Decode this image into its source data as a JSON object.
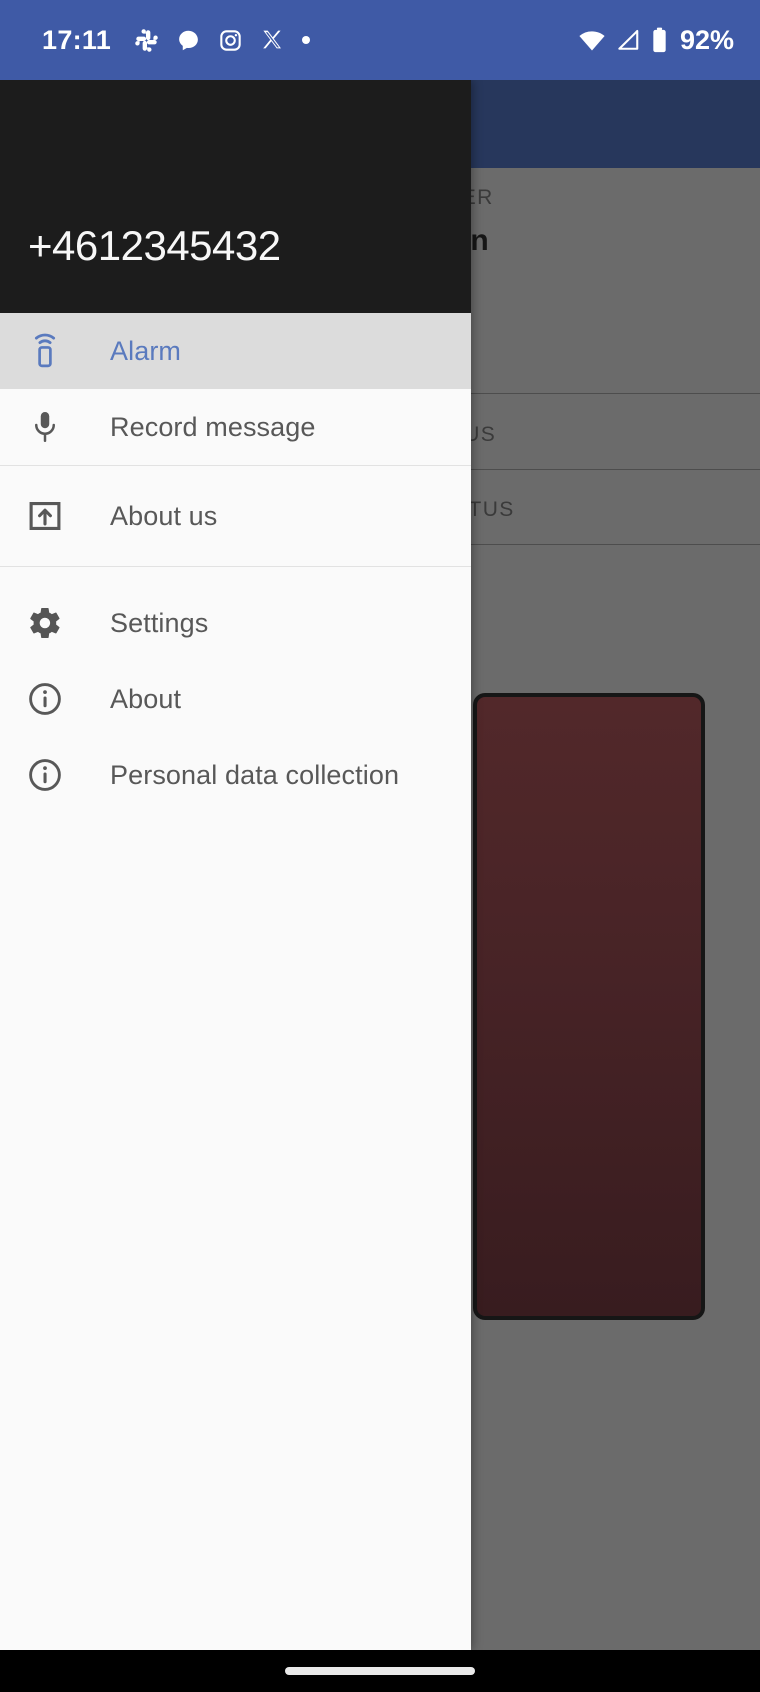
{
  "status_bar": {
    "time": "17:11",
    "battery_percent": "92%",
    "left_icons": [
      "slack-icon",
      "message-icon",
      "instagram-icon",
      "x-icon",
      "dot-icon"
    ],
    "right_icons": [
      "wifi-icon",
      "cellular-signal-icon",
      "battery-icon"
    ],
    "background_color": "#3f5aa6"
  },
  "drawer": {
    "header": {
      "phone_number": "+4612345432",
      "background_color": "#1c1c1c"
    },
    "selected_color": "#5a7abe",
    "selected_row_background": "#dcdcdc",
    "groups": [
      {
        "items": [
          {
            "label": "Alarm",
            "icon": "remote-signal-icon",
            "selected": true
          },
          {
            "label": "Record message",
            "icon": "microphone-icon",
            "selected": false
          }
        ]
      },
      {
        "items": [
          {
            "label": "About us",
            "icon": "open-in-new-icon",
            "selected": false
          }
        ]
      },
      {
        "items": [
          {
            "label": "Settings",
            "icon": "gear-icon",
            "selected": false
          },
          {
            "label": "About",
            "icon": "info-circle-icon",
            "selected": false
          },
          {
            "label": "Personal data collection",
            "icon": "info-circle-icon",
            "selected": false
          }
        ]
      }
    ]
  },
  "background_app": {
    "appbar_color": "#27375c",
    "scrim_color": "#6b6b6b",
    "visible_fragments": [
      {
        "text": "GER",
        "type": "section-label"
      },
      {
        "text": "on",
        "type": "value"
      },
      {
        "text": "TUS",
        "type": "section-label"
      },
      {
        "text": "TATUS",
        "type": "section-label"
      }
    ],
    "card_color": "#472326"
  },
  "nav_bar": {
    "home_indicator": "home-indicator-pill",
    "background_color": "#000000"
  }
}
